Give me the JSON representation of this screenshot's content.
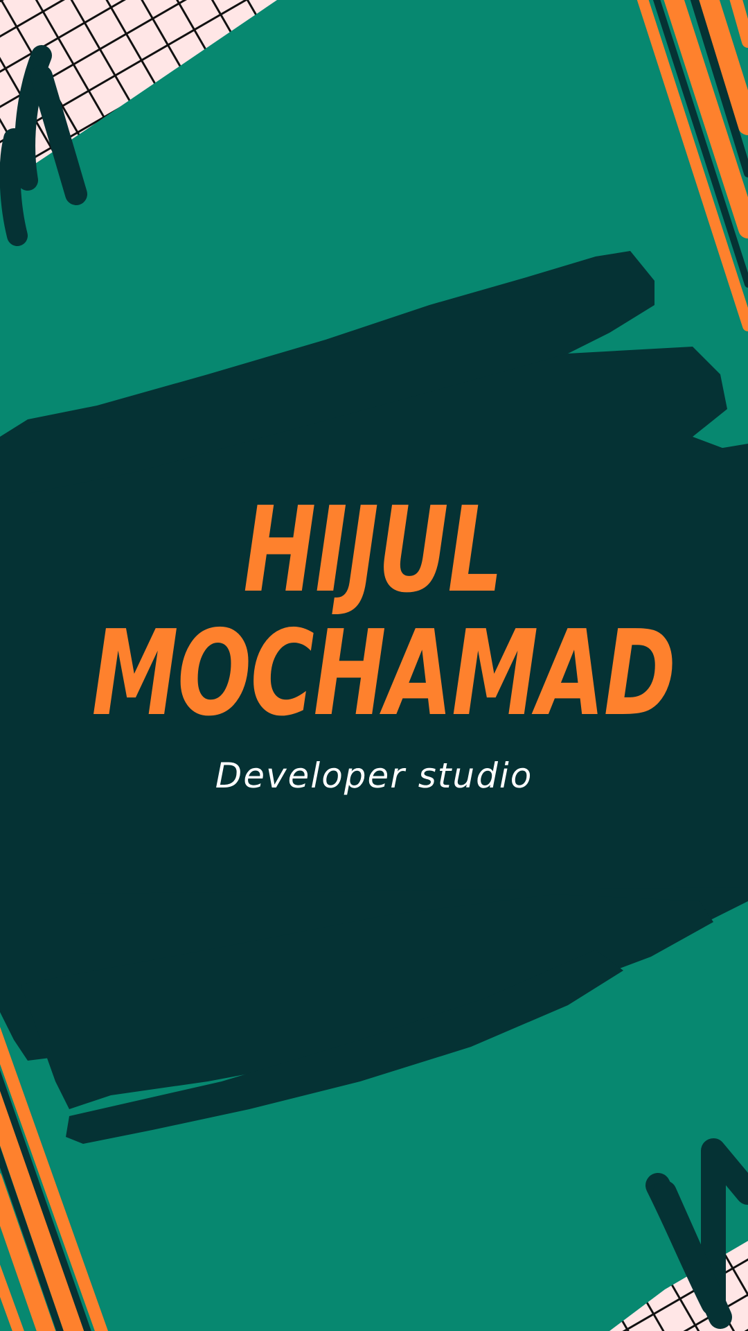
{
  "poster": {
    "title_line1": "HIJUL",
    "title_line2": "MOCHAMAD",
    "subtitle": "Developer studio"
  },
  "colors": {
    "background": "#078870",
    "brush_stroke": "#053234",
    "accent_orange": "#fe812d",
    "subtitle_text": "#ffffff",
    "grid_fill": "#ffe6e6",
    "grid_lines": "#111111"
  }
}
